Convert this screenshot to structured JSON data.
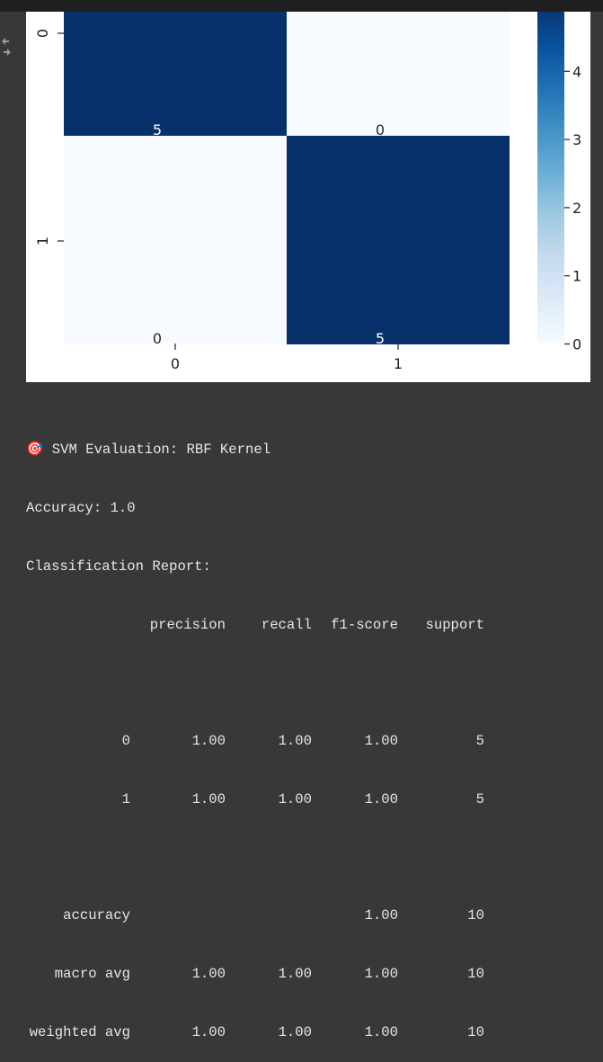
{
  "output": {
    "emoji": "🎯",
    "title": "SVM Evaluation: RBF Kernel",
    "accuracy_line": "Accuracy: 1.0",
    "report_title": "Classification Report:",
    "columns": [
      "precision",
      "recall",
      "f1-score",
      "support"
    ],
    "rows": [
      {
        "label": "0",
        "precision": "1.00",
        "recall": "1.00",
        "f1": "1.00",
        "support": "5"
      },
      {
        "label": "1",
        "precision": "1.00",
        "recall": "1.00",
        "f1": "1.00",
        "support": "5"
      }
    ],
    "summary": [
      {
        "label": "accuracy",
        "precision": "",
        "recall": "",
        "f1": "1.00",
        "support": "10"
      },
      {
        "label": "macro avg",
        "precision": "1.00",
        "recall": "1.00",
        "f1": "1.00",
        "support": "10"
      },
      {
        "label": "weighted avg",
        "precision": "1.00",
        "recall": "1.00",
        "f1": "1.00",
        "support": "10"
      }
    ]
  },
  "chart_data": {
    "type": "heatmap",
    "x_categories": [
      "0",
      "1"
    ],
    "y_categories": [
      "0",
      "1"
    ],
    "values": [
      [
        5,
        0
      ],
      [
        0,
        5
      ]
    ],
    "annotations": [
      [
        "5",
        "0"
      ],
      [
        "0",
        "5"
      ]
    ],
    "colormap": "Blues",
    "colors": {
      "low": "#f7fbff",
      "high": "#08306b"
    },
    "colorbar": {
      "min": 0,
      "max": 5,
      "ticks": [
        "0",
        "1",
        "2",
        "3",
        "4"
      ]
    }
  }
}
